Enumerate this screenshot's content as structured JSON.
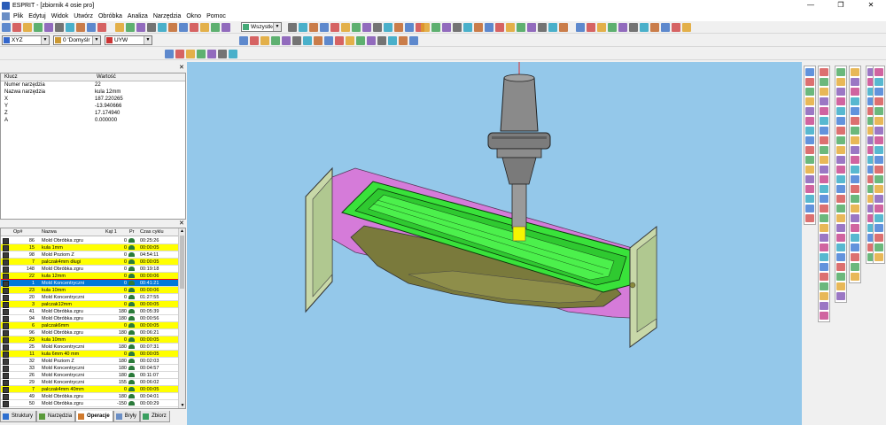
{
  "window": {
    "title": "ESPRIT - [zbiornik 4 osie pro]"
  },
  "menu": [
    "Plik",
    "Edytuj",
    "Widok",
    "Utwórz",
    "Obróbka",
    "Analiza",
    "Narzędzia",
    "Okno",
    "Pomoc"
  ],
  "toolbar": {
    "layer_combo": "Wszystko",
    "plane_combo": "XYZ",
    "work_combo": "0 'Domyślr",
    "view_combo": "UYW"
  },
  "properties": {
    "col_key": "Klucz",
    "col_value": "Wartość",
    "rows": [
      {
        "key": "Numer narzędzia",
        "value": "22"
      },
      {
        "key": "Nazwa narzędzia",
        "value": "kula 12mm"
      },
      {
        "key": "X",
        "value": "187.220265"
      },
      {
        "key": "Y",
        "value": "-13.940666"
      },
      {
        "key": "Z",
        "value": "17.174940"
      },
      {
        "key": "A",
        "value": "0.000000"
      }
    ]
  },
  "operations": {
    "headers": {
      "op": "Op#",
      "name": "Nazwa",
      "angle": "Kąt 1",
      "pr": "Pr",
      "time": "Czas cyklu"
    },
    "rows": [
      {
        "op": "86",
        "name": "Mold Obróbka zgru",
        "angle": "0",
        "time": "00:25:26",
        "style": "w"
      },
      {
        "op": "15",
        "name": "kula 1mm",
        "angle": "0",
        "time": "00:00:05",
        "style": "y"
      },
      {
        "op": "98",
        "name": "Mold Poziom Z",
        "angle": "0",
        "time": "04:54:11",
        "style": "w"
      },
      {
        "op": "7",
        "name": "palczak4mm długi",
        "angle": "0",
        "time": "00:00:05",
        "style": "y"
      },
      {
        "op": "148",
        "name": "Mold Obróbka zgru",
        "angle": "0",
        "time": "00:19:18",
        "style": "w"
      },
      {
        "op": "22",
        "name": "kula 12mm",
        "angle": "0",
        "time": "00:00:06",
        "style": "y"
      },
      {
        "op": "1",
        "name": "Mold Koncentryczni",
        "angle": "0",
        "time": "00:41:21",
        "style": "sel"
      },
      {
        "op": "23",
        "name": "kula 10mm",
        "angle": "0",
        "time": "00:00:06",
        "style": "y"
      },
      {
        "op": "20",
        "name": "Mold Koncentryczni",
        "angle": "0",
        "time": "01:27:55",
        "style": "w"
      },
      {
        "op": "3",
        "name": "palczak12mm",
        "angle": "0",
        "time": "00:00:05",
        "style": "y"
      },
      {
        "op": "41",
        "name": "Mold Obróbka zgru",
        "angle": "180",
        "time": "00:05:39",
        "style": "w"
      },
      {
        "op": "94",
        "name": "Mold Obróbka zgru",
        "angle": "180",
        "time": "00:00:56",
        "style": "w"
      },
      {
        "op": "6",
        "name": "palczak6mm",
        "angle": "0",
        "time": "00:00:05",
        "style": "y"
      },
      {
        "op": "96",
        "name": "Mold Obróbka zgru",
        "angle": "180",
        "time": "00:06:21",
        "style": "w"
      },
      {
        "op": "23",
        "name": "kula 10mm",
        "angle": "0",
        "time": "00:00:05",
        "style": "y"
      },
      {
        "op": "25",
        "name": "Mold Koncentryczni",
        "angle": "180",
        "time": "00:07:31",
        "style": "w"
      },
      {
        "op": "11",
        "name": "kula 6mm 40 mm",
        "angle": "0",
        "time": "00:00:05",
        "style": "y"
      },
      {
        "op": "32",
        "name": "Mold Poziom Z",
        "angle": "180",
        "time": "00:02:03",
        "style": "w"
      },
      {
        "op": "33",
        "name": "Mold Koncentryczni",
        "angle": "180",
        "time": "00:04:57",
        "style": "w"
      },
      {
        "op": "26",
        "name": "Mold Koncentryczni",
        "angle": "180",
        "time": "00:11:07",
        "style": "w"
      },
      {
        "op": "29",
        "name": "Mold Koncentryczni",
        "angle": "155",
        "time": "00:06:02",
        "style": "w"
      },
      {
        "op": "7",
        "name": "palczak4mm 40mm",
        "angle": "0",
        "time": "00:00:05",
        "style": "y"
      },
      {
        "op": "49",
        "name": "Mold Obróbka zgru",
        "angle": "180",
        "time": "00:04:01",
        "style": "w"
      },
      {
        "op": "50",
        "name": "Mold Obróbka zgru",
        "angle": "-150",
        "time": "00:00:29",
        "style": "w"
      }
    ]
  },
  "tabs": [
    {
      "label": "Struktury",
      "color": "#2d6fd0"
    },
    {
      "label": "Narzędzia",
      "color": "#5a9a3a"
    },
    {
      "label": "Operacje",
      "color": "#d07a2d"
    },
    {
      "label": "Bryły",
      "color": "#6b8fc6"
    },
    {
      "label": "Zbiorz",
      "color": "#3aa060"
    }
  ],
  "icons": {
    "app": "esprit-app-icon",
    "minimize": "—",
    "maximize": "❐",
    "close": "✕",
    "panel_close": "✕",
    "scroll_up": "▲",
    "scroll_down": "▼",
    "dropdown": "▼",
    "tool": "cnc-tool-holder-icon",
    "workpiece": "mold-workpiece-icon"
  },
  "colors": {
    "viewport_bg": "#94c8ea",
    "selected_row": "#0078d7",
    "highlight_row": "#ffff00",
    "part_green": "#39e23a",
    "stock_pink": "#d977d9",
    "stock_olive": "#7a7a3c",
    "tool_grey": "#8a8a8a"
  }
}
